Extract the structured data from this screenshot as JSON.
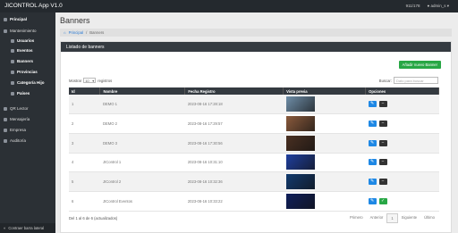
{
  "app": {
    "title": "JICONTROL App V1.0",
    "notif": "911/178",
    "user": "admin_s"
  },
  "sidebar": {
    "items": [
      {
        "label": "Principal"
      },
      {
        "label": "Mantenimiento"
      },
      {
        "label": "Usuarios"
      },
      {
        "label": "Eventos"
      },
      {
        "label": "Banners"
      },
      {
        "label": "Provincias"
      },
      {
        "label": "Categoría Hijo"
      },
      {
        "label": "Países"
      },
      {
        "label": "QR Lector"
      },
      {
        "label": "Mensajería"
      },
      {
        "label": "Empresa"
      },
      {
        "label": "Auditoría"
      }
    ],
    "footer": "Contraer barra lateral"
  },
  "page": {
    "title": "Banners",
    "breadcrumb": {
      "home": "Principal",
      "sep": "/",
      "current": "Banners"
    },
    "card_title": "Listado de banners",
    "add_button": "Añadir nuevo Banner",
    "show_label": "Mostrar",
    "show_value": "10",
    "records_label": "registros",
    "search_label": "Buscar:",
    "search_placeholder": "Dato para buscar"
  },
  "table": {
    "headers": [
      "Id",
      "Nombre",
      "Fecha Registro",
      "Vista previa",
      "Opciones"
    ],
    "rows": [
      {
        "id": "1",
        "nombre": "DEMO 1",
        "fecha": "2023-08-16 17:28:18",
        "thumb": "#6f8ea8",
        "opt2": "minus"
      },
      {
        "id": "2",
        "nombre": "DEMO 2",
        "fecha": "2023-08-16 17:29:57",
        "thumb": "#8a5a3c",
        "opt2": "minus"
      },
      {
        "id": "3",
        "nombre": "DEMO 3",
        "fecha": "2023-08-16 17:30:56",
        "thumb": "#4a3022",
        "opt2": "minus"
      },
      {
        "id": "4",
        "nombre": "JIControl 1",
        "fecha": "2023-08-16 10:31:10",
        "thumb": "#1f3f9e",
        "opt2": "minus"
      },
      {
        "id": "5",
        "nombre": "JIControl 2",
        "fecha": "2023-08-16 10:32:36",
        "thumb": "#123a6e",
        "opt2": "minus"
      },
      {
        "id": "6",
        "nombre": "JIControl Eventos",
        "fecha": "2023-08-16 10:33:22",
        "thumb": "#0f1f5a",
        "opt2": "check"
      }
    ]
  },
  "footer": {
    "info": "Del 1 al 6 de 6 (actualizados)",
    "pager": [
      "Primero",
      "Anterior",
      "1",
      "Siguiente",
      "Último"
    ]
  }
}
